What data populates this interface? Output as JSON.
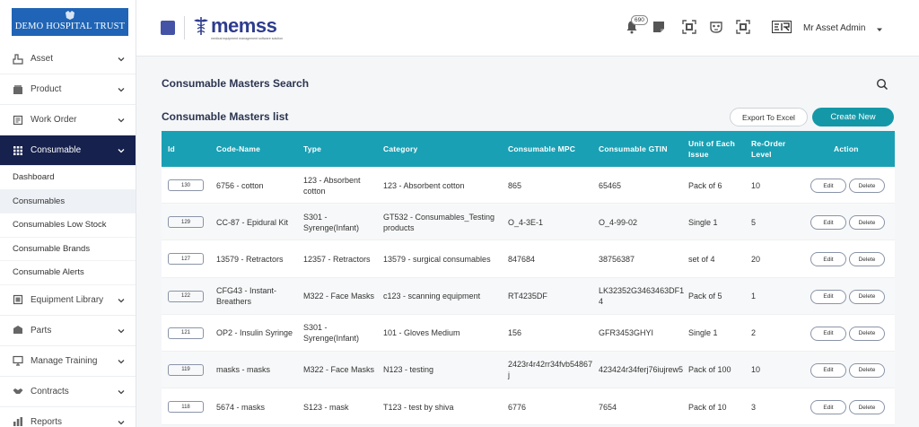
{
  "brand": {
    "name": "DEMO HOSPITAL TRUST"
  },
  "sidebar": {
    "items": [
      {
        "label": "Asset",
        "icon": "asset-icon"
      },
      {
        "label": "Product",
        "icon": "product-icon"
      },
      {
        "label": "Work Order",
        "icon": "work-order-icon"
      },
      {
        "label": "Consumable",
        "icon": "grid-icon"
      },
      {
        "label": "Equipment Library",
        "icon": "library-icon"
      },
      {
        "label": "Parts",
        "icon": "parts-icon"
      },
      {
        "label": "Manage Training",
        "icon": "monitor-icon"
      },
      {
        "label": "Contracts",
        "icon": "handshake-icon"
      },
      {
        "label": "Reports",
        "icon": "reports-icon"
      }
    ],
    "sub_items": [
      {
        "label": "Dashboard"
      },
      {
        "label": "Consumables"
      },
      {
        "label": "Consumables Low Stock"
      },
      {
        "label": "Consumable Brands"
      },
      {
        "label": "Consumable Alerts"
      }
    ]
  },
  "header": {
    "logo_text": "memss",
    "logo_tagline": "medical equipment management software solution",
    "notification_count": "690",
    "user_name": "Mr Asset Admin"
  },
  "main": {
    "page_title": "Consumable Masters Search",
    "list_title": "Consumable Masters list",
    "export_label": "Export To Excel",
    "create_label": "Create New",
    "edit_label": "Edit",
    "delete_label": "Delete",
    "columns": [
      "Id",
      "Code-Name",
      "Type",
      "Category",
      "Consumable MPC",
      "Consumable GTIN",
      "Unit of Each Issue",
      "Re-Order Level",
      "Action"
    ],
    "rows": [
      {
        "id": "130",
        "code_name": "6756 - cotton",
        "type": "123 - Absorbent cotton",
        "category": "123 - Absorbent cotton",
        "mpc": "865",
        "gtin": "65465",
        "unit": "Pack of 6",
        "reorder": "10"
      },
      {
        "id": "129",
        "code_name": "CC-87 - Epidural Kit",
        "type": "S301 - Syrenge(Infant)",
        "category": "GT532 - Consumables_Testing products",
        "mpc": "O_4-3E-1",
        "gtin": "O_4-99-02",
        "unit": "Single 1",
        "reorder": "5"
      },
      {
        "id": "127",
        "code_name": "13579 - Retractors",
        "type": "12357 - Retractors",
        "category": "13579 - surgical consumables",
        "mpc": "847684",
        "gtin": "38756387",
        "unit": "set of 4",
        "reorder": "20"
      },
      {
        "id": "122",
        "code_name": "CFG43 - Instant-Breathers",
        "type": "M322 - Face Masks",
        "category": "c123 - scanning equipment",
        "mpc": "RT4235DF",
        "gtin": "LK32352G3463463DF14",
        "unit": "Pack of 5",
        "reorder": "1"
      },
      {
        "id": "121",
        "code_name": "OP2 - Insulin Syringe",
        "type": "S301 - Syrenge(Infant)",
        "category": "101 - Gloves Medium",
        "mpc": "156",
        "gtin": "GFR3453GHYI",
        "unit": "Single 1",
        "reorder": "2"
      },
      {
        "id": "119",
        "code_name": "masks - masks",
        "type": "M322 - Face Masks",
        "category": "N123 - testing",
        "mpc": "2423r4r42rr34fvb54867j",
        "gtin": "423424r34ferj76iujrew5",
        "unit": "Pack of 100",
        "reorder": "10"
      },
      {
        "id": "118",
        "code_name": "5674 - masks",
        "type": "S123 - mask",
        "category": "T123 - test by shiva",
        "mpc": "6776",
        "gtin": "7654",
        "unit": "Pack of 10",
        "reorder": "3"
      }
    ]
  },
  "colors": {
    "sidebar_active": "#16214d",
    "table_header": "#1aa0b4",
    "create_button": "#1498a8",
    "brand_bg": "#1f64b6"
  }
}
